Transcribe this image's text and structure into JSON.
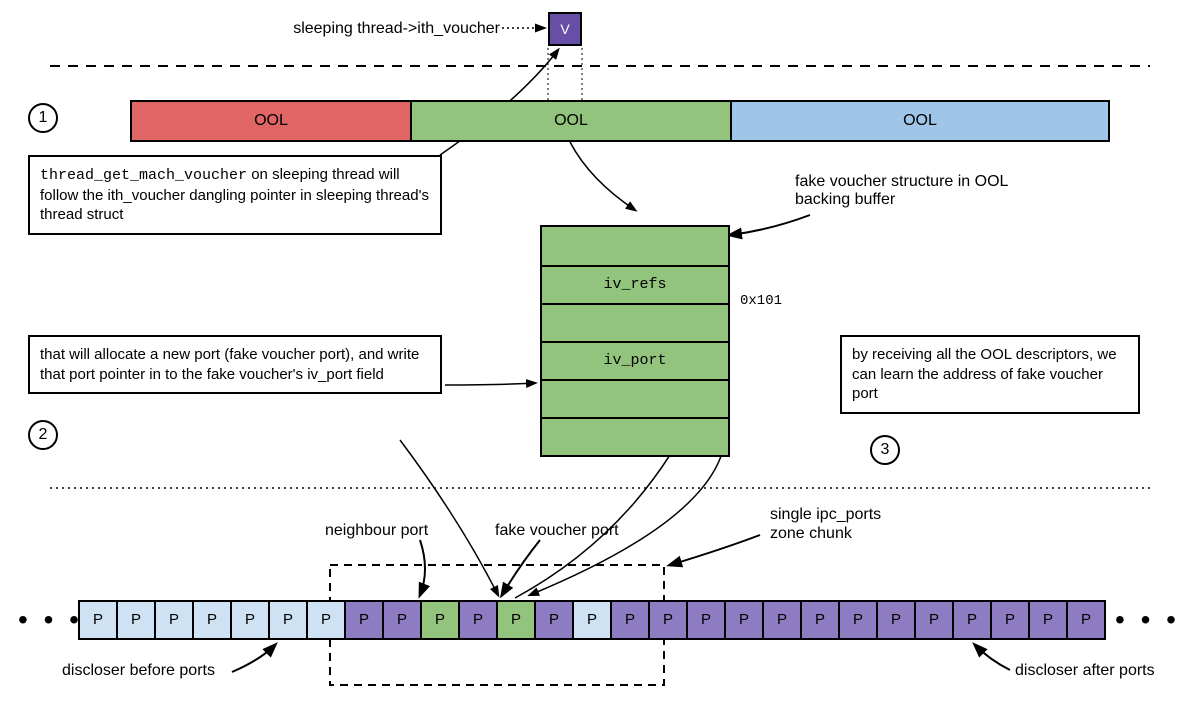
{
  "top": {
    "sleeping_label": "sleeping thread->ith_voucher",
    "v_letter": "V"
  },
  "ool": {
    "seg1": "OOL",
    "seg2": "OOL",
    "seg3": "OOL"
  },
  "steps": {
    "one": "1",
    "two": "2",
    "three": "3",
    "text1a": "thread_get_mach_voucher",
    "text1b": " on sleeping thread will follow the ith_voucher dangling pointer in sleeping thread's thread struct",
    "text2": "that will allocate a new port (fake voucher port), and write that port pointer in to the fake voucher's iv_port field",
    "text3": "by receiving all the OOL descriptors, we can learn the address of fake voucher port"
  },
  "struct_labels": {
    "fake_voucher_struct": "fake voucher structure in OOL backing buffer",
    "iv_refs": "iv_refs",
    "iv_port": "iv_port",
    "hex": "0x101"
  },
  "bottom": {
    "neighbour": "neighbour port",
    "fake_voucher_port": "fake voucher port",
    "zone_chunk_a": "single ipc_ports",
    "zone_chunk_b": "zone chunk",
    "discloser_before": "discloser before ports",
    "discloser_after": "discloser after ports",
    "port_letter": "P",
    "ellipsis": "• • •"
  }
}
